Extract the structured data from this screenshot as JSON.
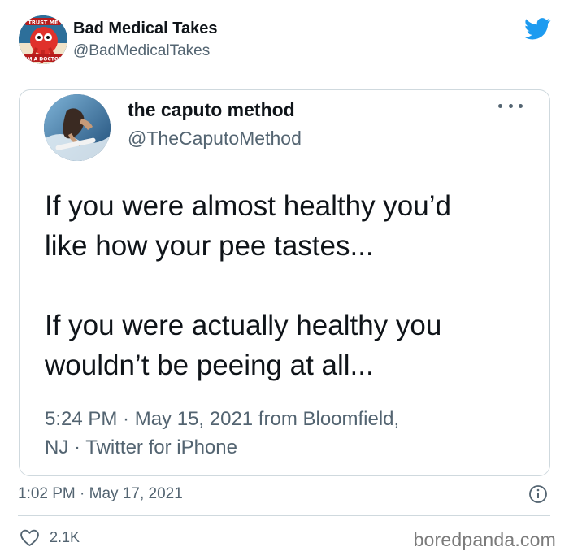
{
  "outer_tweet": {
    "author_name": "Bad Medical Takes",
    "author_handle": "@BadMedicalTakes",
    "avatar_badge_top": "TRUST ME",
    "avatar_badge_bottom": "I'M A DOCTOR",
    "timestamp": "1:02 PM · May 17, 2021",
    "like_count": "2.1K"
  },
  "quoted_tweet": {
    "author_name": "the caputo method",
    "author_handle": "@TheCaputoMethod",
    "lines_para1": [
      "If you were almost healthy you’d",
      "like how your pee tastes..."
    ],
    "lines_para2": [
      "If you were actually healthy you",
      "wouldn’t be peeing at all..."
    ],
    "meta_line1": "5:24 PM · May 15, 2021 from Bloomfield,",
    "meta_line2": "NJ · Twitter for iPhone"
  },
  "watermark": "boredpanda.com",
  "icons": {
    "brand": "twitter-bird-icon",
    "more": "more-options-icon",
    "info": "info-icon",
    "like": "heart-icon"
  },
  "colors": {
    "twitter_blue": "#1d9bf0",
    "text_primary": "#0f1419",
    "text_secondary": "#536471",
    "border": "#cfd9de"
  }
}
